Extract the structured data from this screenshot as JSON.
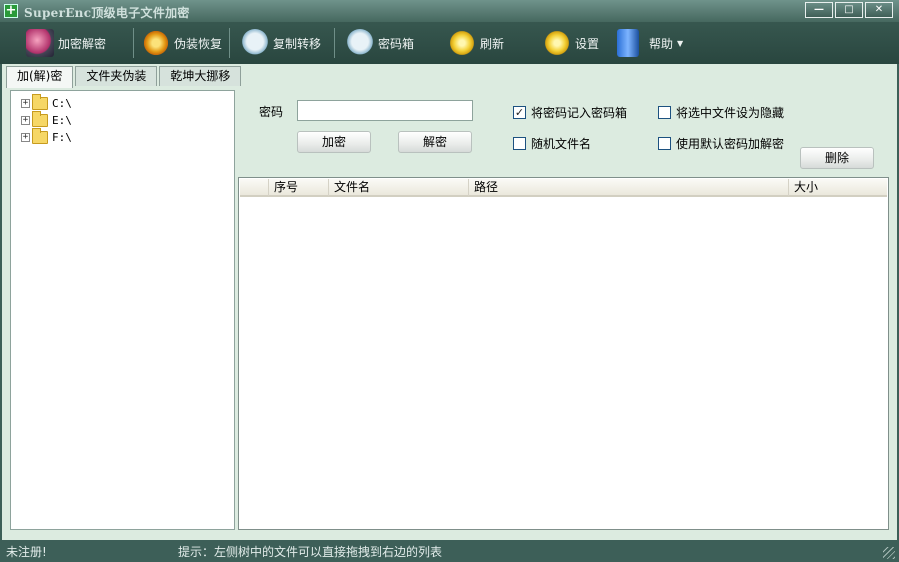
{
  "window": {
    "title": "SuperEnc顶级电子文件加密",
    "app_icon": "plus-icon",
    "controls": {
      "minimize": "—",
      "maximize": "□",
      "close": "✕"
    }
  },
  "toolbar": {
    "items": [
      {
        "label": "加密解密",
        "icon": "pc-icon"
      },
      {
        "label": "伪装恢复",
        "icon": "gear-icon"
      },
      {
        "label": "复制转移",
        "icon": "bear-icon"
      },
      {
        "label": "密码箱",
        "icon": "bear-icon"
      },
      {
        "label": "刷新",
        "icon": "sun-icon"
      },
      {
        "label": "设置",
        "icon": "sun-icon"
      },
      {
        "label": "帮助",
        "icon": "box-icon",
        "caret": "▼"
      }
    ]
  },
  "tabs": [
    "加(解)密",
    "文件夹伪装",
    "乾坤大挪移"
  ],
  "tree": {
    "drives": [
      "C:\\",
      "E:\\",
      "F:\\"
    ],
    "expander": "+"
  },
  "options": {
    "password_label": "密码",
    "password_value": "",
    "encrypt_button": "加密",
    "decrypt_button": "解密",
    "delete_button": "删除",
    "checkboxes": [
      {
        "label": "将密码记入密码箱",
        "checked": true
      },
      {
        "label": "将选中文件设为隐藏",
        "checked": false
      },
      {
        "label": "随机文件名",
        "checked": false
      },
      {
        "label": "使用默认密码加解密",
        "checked": false
      }
    ],
    "check_mark": "✓"
  },
  "list": {
    "columns": [
      "序号",
      "文件名",
      "路径",
      "大小"
    ],
    "rows": []
  },
  "status": {
    "registration": "未注册!",
    "hint": "提示：左侧树中的文件可以直接拖拽到右边的列表"
  }
}
